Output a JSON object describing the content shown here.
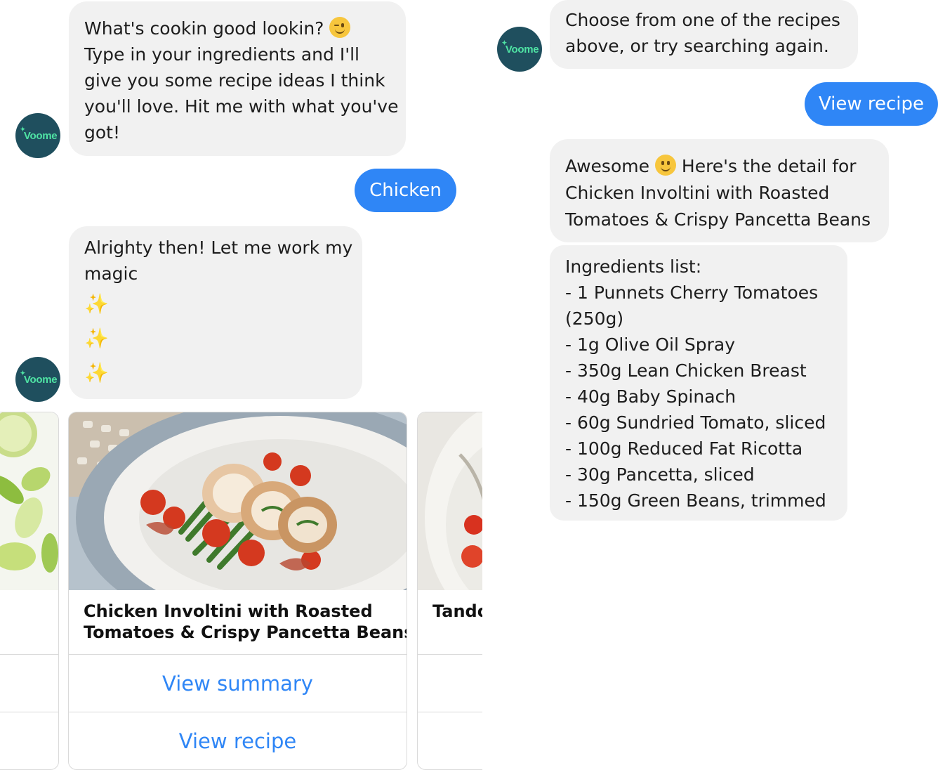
{
  "bot": {
    "avatar_text": "Voome",
    "brand_color": "#1f4f5e",
    "accent_color": "#4fe3a4"
  },
  "left": {
    "greeting_lines": [
      "What's cookin good lookin?",
      "Type in your ingredients and I'll",
      "give you some recipe ideas I think",
      "you'll love. Hit me with what you've",
      "got!"
    ],
    "greeting_emoji": "wink-emoji",
    "user_reply": "Chicken",
    "magic_lines": [
      "Alrighty then! Let me work my",
      "magic"
    ],
    "sparkles": [
      "✨",
      "✨",
      "✨"
    ],
    "cards": [
      {
        "title": "",
        "actions": [
          "",
          ""
        ]
      },
      {
        "title_lines": [
          "Chicken Involtini with Roasted",
          "Tomatoes & Crispy Pancetta Beans"
        ],
        "actions": [
          "View summary",
          "View recipe"
        ]
      },
      {
        "title": "Tando",
        "actions": [
          "",
          ""
        ]
      }
    ]
  },
  "right": {
    "prompt_lines": [
      "Choose from one of the recipes",
      "above, or try searching again."
    ],
    "user_reply": "View recipe",
    "detail_intro": "Awesome",
    "detail_emoji": "smile-emoji",
    "detail_lines": [
      "Here's the detail for",
      "Chicken Involtini with Roasted",
      "Tomatoes & Crispy Pancetta Beans"
    ],
    "ingredients_header": "Ingredients list:",
    "ingredients": [
      "- 1 Punnets Cherry Tomatoes",
      "(250g)",
      "- 1g Olive Oil Spray",
      "- 350g Lean Chicken Breast",
      "- 40g Baby Spinach",
      "- 60g Sundried Tomato, sliced",
      "- 100g Reduced Fat Ricotta",
      "- 30g Pancetta, sliced",
      "- 150g Green Beans, trimmed"
    ]
  }
}
